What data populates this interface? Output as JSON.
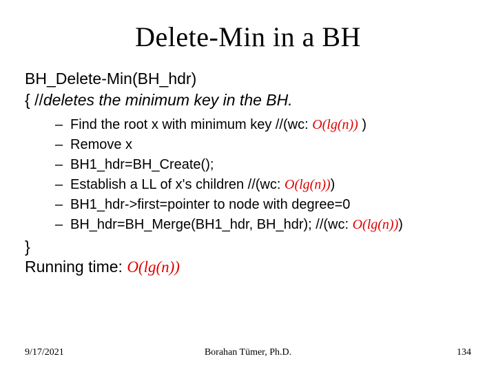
{
  "title": "Delete-Min in a BH",
  "line1": "BH_Delete-Min(BH_hdr)",
  "line2_prefix": "{ //",
  "line2_comment": "deletes the minimum key in the BH.",
  "bullets": [
    {
      "dash": "–",
      "pre": "Find the root x with minimum key //(wc: ",
      "cx": "O(lg(n))",
      "post": " )"
    },
    {
      "dash": "–",
      "pre": "Remove x",
      "cx": "",
      "post": ""
    },
    {
      "dash": "–",
      "pre": "BH1_hdr=BH_Create();",
      "cx": "",
      "post": ""
    },
    {
      "dash": "–",
      "pre": "Establish a LL of x's children //(wc: ",
      "cx": "O(lg(n))",
      "post": ")"
    },
    {
      "dash": "–",
      "pre": "BH1_hdr->first=pointer to node with degree=0",
      "cx": "",
      "post": ""
    },
    {
      "dash": "–",
      "pre": "BH_hdr=BH_Merge(BH1_hdr, BH_hdr); //(wc: ",
      "cx": "O(lg(n))",
      "post": ")"
    }
  ],
  "close_brace": "}",
  "runtime_label": "Running time: ",
  "runtime_cx": "O(lg(n))",
  "footer": {
    "date": "9/17/2021",
    "author": "Borahan Tümer, Ph.D.",
    "page": "134"
  }
}
